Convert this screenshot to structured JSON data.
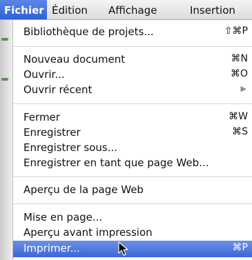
{
  "menubar": {
    "items": [
      "Fichier",
      "Édition",
      "Affichage",
      "Insertion"
    ],
    "active_index": 0
  },
  "menu": {
    "bibliotheque": {
      "label": "Bibliothèque de projets...",
      "shortcut": "⇧⌘P"
    },
    "nouveau": {
      "label": "Nouveau document",
      "shortcut": "⌘N"
    },
    "ouvrir": {
      "label": "Ouvrir...",
      "shortcut": "⌘O"
    },
    "ouvrir_recent": {
      "label": "Ouvrir récent",
      "submenu_arrow": "▶"
    },
    "fermer": {
      "label": "Fermer",
      "shortcut": "⌘W"
    },
    "enregistrer": {
      "label": "Enregistrer",
      "shortcut": "⌘S"
    },
    "enregistrer_sous": {
      "label": "Enregistrer sous..."
    },
    "enregistrer_web": {
      "label": "Enregistrer en tant que page Web..."
    },
    "apercu_web": {
      "label": "Aperçu de la page Web"
    },
    "mise_en_page": {
      "label": "Mise en page..."
    },
    "apercu_impression": {
      "label": "Aperçu avant impression"
    },
    "imprimer": {
      "label": "Imprimer...",
      "shortcut": "⌘P",
      "highlighted": true
    }
  },
  "colors": {
    "highlight": "#3d66d6",
    "annotation_red": "#f02a14",
    "menubar_bg": "#dcdcdc"
  }
}
